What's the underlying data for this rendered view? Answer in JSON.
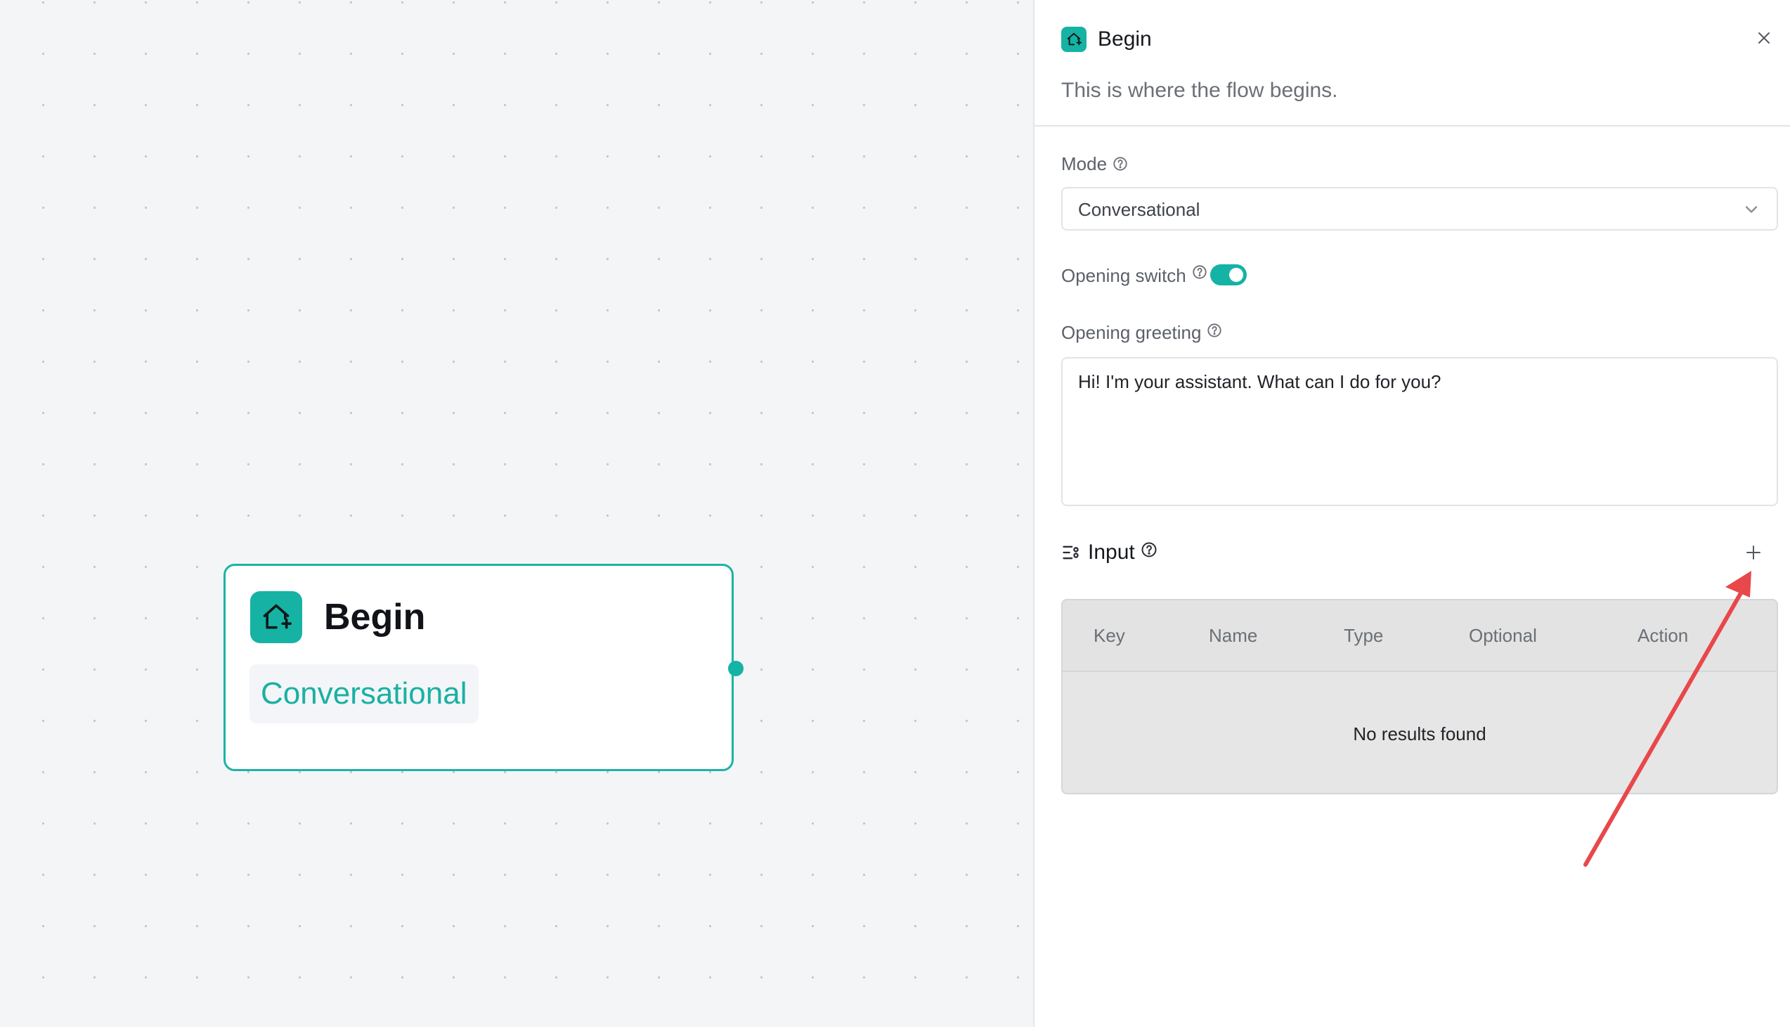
{
  "canvas": {
    "node": {
      "title": "Begin",
      "tag": "Conversational",
      "icon": "home-plus-icon"
    }
  },
  "panel": {
    "header": {
      "icon": "home-plus-icon",
      "title": "Begin",
      "description": "This is where the flow begins.",
      "close_icon": "close-icon"
    },
    "mode": {
      "label": "Mode",
      "value": "Conversational"
    },
    "opening_switch": {
      "label": "Opening switch",
      "on": true
    },
    "opening_greeting": {
      "label": "Opening greeting",
      "value": "Hi! I'm your assistant. What can I do for you?"
    },
    "input": {
      "title": "Input",
      "columns": [
        "Key",
        "Name",
        "Type",
        "Optional",
        "Action"
      ],
      "empty_text": "No results found"
    }
  },
  "colors": {
    "accent": "#14b3a5",
    "annotation_arrow": "#e8484a"
  }
}
